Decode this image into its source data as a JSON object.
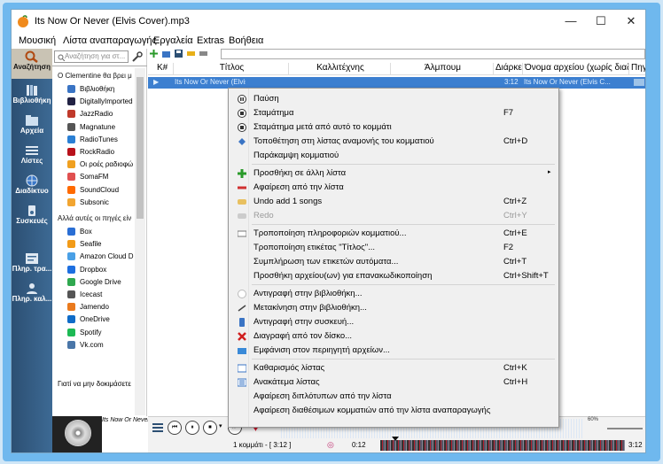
{
  "window": {
    "title": "Its Now Or Never (Elvis Cover).mp3",
    "minimize": "—",
    "maximize": "☐",
    "close": "✕"
  },
  "menu": [
    "Μουσική",
    "Λίστα αναπαραγωγής",
    "Εργαλεία",
    "Extras",
    "Βοήθεια"
  ],
  "tabs": [
    {
      "label": "Αναζήτηση",
      "icon": "search-icon"
    },
    {
      "label": "Βιβλιοθήκη",
      "icon": "library-icon"
    },
    {
      "label": "Αρχεία",
      "icon": "folder-icon"
    },
    {
      "label": "Λίστες",
      "icon": "playlist-icon"
    },
    {
      "label": "Διαδίκτυο",
      "icon": "globe-icon"
    },
    {
      "label": "Συσκευές",
      "icon": "device-icon"
    },
    {
      "label": "Πληρ. τρα...",
      "icon": "track-info-icon"
    },
    {
      "label": "Πληρ. καλ...",
      "icon": "artist-info-icon"
    }
  ],
  "sidebar": {
    "search_placeholder": "Αναζήτηση για στ...",
    "group1_header": "Ο Clementine θα βρει μ",
    "group1": [
      {
        "label": "Βιβλιοθήκη",
        "color": "#3a74c4"
      },
      {
        "label": "DigitallyImported",
        "color": "#222244"
      },
      {
        "label": "JazzRadio",
        "color": "#c0392b"
      },
      {
        "label": "Magnatune",
        "color": "#555555"
      },
      {
        "label": "RadioTunes",
        "color": "#2a7fd4"
      },
      {
        "label": "RockRadio",
        "color": "#b8121b"
      },
      {
        "label": "Οι ροές ραδιοφώ",
        "color": "#f0a020"
      },
      {
        "label": "SomaFM",
        "color": "#e05050"
      },
      {
        "label": "SoundCloud",
        "color": "#ff6a00"
      },
      {
        "label": "Subsonic",
        "color": "#f2a531"
      }
    ],
    "group2_header": "Αλλά αυτές οι πηγές είν",
    "group2": [
      {
        "label": "Box",
        "color": "#2a6ed4"
      },
      {
        "label": "Seafile",
        "color": "#f29b18"
      },
      {
        "label": "Amazon Cloud D",
        "color": "#4aa0e6"
      },
      {
        "label": "Dropbox",
        "color": "#1d6fe0"
      },
      {
        "label": "Google Drive",
        "color": "#2fa84f"
      },
      {
        "label": "Icecast",
        "color": "#555555"
      },
      {
        "label": "Jamendo",
        "color": "#ea7a1d"
      },
      {
        "label": "OneDrive",
        "color": "#0f6cc8"
      },
      {
        "label": "Spotify",
        "color": "#1db954"
      },
      {
        "label": "Vk.com",
        "color": "#4a76a8"
      }
    ],
    "footer": "Γιατί να μην δοκιμάσετε"
  },
  "playlist": {
    "columns": [
      "K#",
      "Τίτλος",
      "Καλλιτέχνης",
      "Άλμπουμ",
      "Διάρκει",
      "Όνομα αρχείου (χωρίς διαδρομ",
      "Πηγή"
    ],
    "row": {
      "title": "Its Now Or Never (Elvis ...",
      "length": "3:12",
      "filename": "Its Now Or Never (Elvis C..."
    }
  },
  "now_playing": {
    "text": "Its Now Or Never (El",
    "status": "1 κομμάτι - [ 3:12 ]",
    "time_elapsed": "0:12",
    "time_total": "3:12",
    "volume": "60%",
    "seek_position": 0.06
  },
  "context_menu": [
    {
      "label": "Παύση",
      "shortcut": "",
      "icon": "pause-icon",
      "disabled": false
    },
    {
      "label": "Σταμάτημα",
      "shortcut": "F7",
      "icon": "stop-icon",
      "disabled": false
    },
    {
      "label": "Σταμάτημα μετά από αυτό το κομμάτι",
      "shortcut": "",
      "icon": "stop-after-icon",
      "disabled": false
    },
    {
      "label": "Τοποθέτηση στη λίστας αναμονής του κομματιού",
      "shortcut": "Ctrl+D",
      "icon": "queue-icon",
      "disabled": false
    },
    {
      "label": "Παράκαμψη κομματιού",
      "shortcut": "",
      "icon": "",
      "disabled": false
    },
    {
      "label": "Προσθήκη σε άλλη λίστα",
      "shortcut": "",
      "icon": "plus-icon",
      "disabled": false,
      "submenu": true
    },
    {
      "label": "Αφαίρεση από την λίστα",
      "shortcut": "",
      "icon": "minus-icon",
      "disabled": false
    },
    {
      "label": "Undo add 1 songs",
      "shortcut": "Ctrl+Z",
      "icon": "undo-icon",
      "disabled": false
    },
    {
      "label": "Redo",
      "shortcut": "Ctrl+Y",
      "icon": "redo-icon",
      "disabled": true
    },
    {
      "label": "Τροποποίηση πληροφοριών κομματιού...",
      "shortcut": "Ctrl+E",
      "icon": "edit-info-icon",
      "disabled": false
    },
    {
      "label": "Τροποποίηση ετικέτας \"Τίτλος\"...",
      "shortcut": "F2",
      "icon": "",
      "disabled": false
    },
    {
      "label": "Συμπλήρωση των ετικετών αυτόματα...",
      "shortcut": "Ctrl+T",
      "icon": "",
      "disabled": false
    },
    {
      "label": "Προσθήκη αρχείου(ων) για επανακωδικοποίηση",
      "shortcut": "Ctrl+Shift+T",
      "icon": "",
      "disabled": false
    },
    {
      "label": "Αντιγραφή στην βιβλιοθήκη...",
      "shortcut": "",
      "icon": "copy-icon",
      "disabled": false
    },
    {
      "label": "Μετακίνηση στην βιβλιοθήκη...",
      "shortcut": "",
      "icon": "move-icon",
      "disabled": false
    },
    {
      "label": "Αντιγραφή στην συσκευή...",
      "shortcut": "",
      "icon": "device-copy-icon",
      "disabled": false
    },
    {
      "label": "Διαγραφή από τον δίσκο...",
      "shortcut": "",
      "icon": "delete-icon",
      "disabled": false
    },
    {
      "label": "Εμφάνιση στον περιηγητή αρχείων...",
      "shortcut": "",
      "icon": "folder-open-icon",
      "disabled": false
    },
    {
      "label": "Καθαρισμός λίστας",
      "shortcut": "Ctrl+K",
      "icon": "clear-icon",
      "disabled": false
    },
    {
      "label": "Ανακάτεμα λίστας",
      "shortcut": "Ctrl+H",
      "icon": "shuffle-icon",
      "disabled": false
    },
    {
      "label": "Αφαίρεση διπλότυπων από την λίστα",
      "shortcut": "",
      "icon": "",
      "disabled": false
    },
    {
      "label": "Αφαίρεση διαθέσιμων κομματιών από την λίστα αναπαραγωγής",
      "shortcut": "",
      "icon": "",
      "disabled": false
    }
  ]
}
